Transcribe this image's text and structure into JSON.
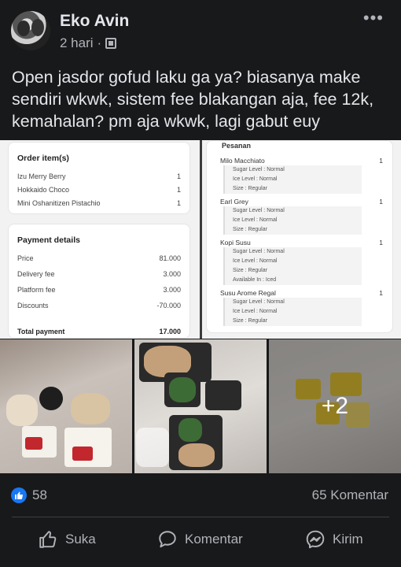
{
  "post": {
    "author": "Eko Avin",
    "time": "2 hari",
    "separator": "·",
    "privacy_icon": "album-icon",
    "more_label": "•••",
    "text": "Open jasdor gofud laku ga ya? biasanya make sendiri wkwk, sistem fee blakangan aja, fee 12k, kemahalan? pm aja wkwk, lagi gabut euy"
  },
  "receipt": {
    "order_title": "Order item(s)",
    "items": [
      {
        "name": "Izu Merry Berry",
        "qty": "1"
      },
      {
        "name": "Hokkaido Choco",
        "qty": "1"
      },
      {
        "name": "Mini Oshanitizen Pistachio",
        "qty": "1"
      }
    ],
    "payment_title": "Payment details",
    "payment_rows": [
      {
        "label": "Price",
        "value": "81.000"
      },
      {
        "label": "Delivery fee",
        "value": "3.000"
      },
      {
        "label": "Platform fee",
        "value": "3.000"
      },
      {
        "label": "Discounts",
        "value": "-70.000"
      }
    ],
    "total_label": "Total payment",
    "total_value": "17.000"
  },
  "pesanan": {
    "title": "Pesanan",
    "items": [
      {
        "name": "Milo Macchiato",
        "qty": "1",
        "details": [
          "Sugar Level : Normal",
          "Ice Level : Normal",
          "Size : Regular"
        ]
      },
      {
        "name": "Earl Grey",
        "qty": "1",
        "details": [
          "Sugar Level : Normal",
          "Ice Level : Normal",
          "Size : Regular"
        ]
      },
      {
        "name": "Kopi Susu",
        "qty": "1",
        "details": [
          "Sugar Level : Normal",
          "Ice Level : Normal",
          "Size : Regular",
          "Available In : Iced"
        ]
      },
      {
        "name": "Susu Arome Regal",
        "qty": "1",
        "details": [
          "Sugar Level : Normal",
          "Ice Level : Normal",
          "Size : Regular"
        ]
      }
    ]
  },
  "photos": {
    "more_label": "+2"
  },
  "stats": {
    "likes": "58",
    "comments": "65 Komentar"
  },
  "actions": {
    "like": "Suka",
    "comment": "Komentar",
    "send": "Kirim"
  },
  "colors": {
    "background": "#18191a",
    "text": "#e4e6eb",
    "muted": "#b0b3b8",
    "like_blue": "#1877f2"
  }
}
